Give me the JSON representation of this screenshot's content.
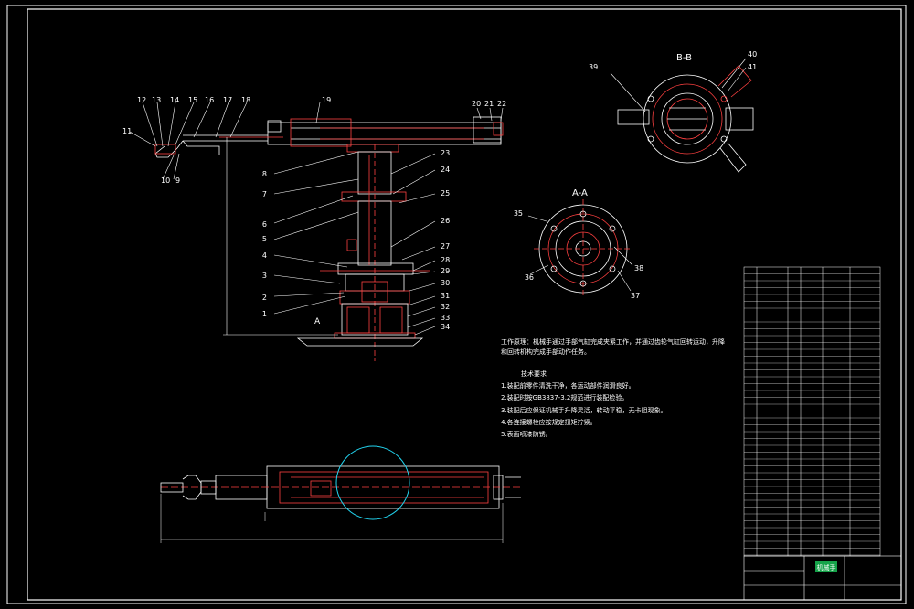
{
  "section_labels": {
    "a_a": "A-A",
    "b_b": "B-B",
    "a_ref": "A"
  },
  "balloons_left": [
    "1",
    "2",
    "3",
    "4",
    "5",
    "6",
    "7",
    "8"
  ],
  "balloons_right": [
    "23",
    "24",
    "25",
    "26",
    "27",
    "28",
    "29",
    "30",
    "31",
    "32",
    "33",
    "34"
  ],
  "balloons_top": [
    "9",
    "10",
    "11",
    "12",
    "13",
    "14",
    "15",
    "16",
    "17",
    "18",
    "19",
    "20",
    "21",
    "22"
  ],
  "balloons_aa": [
    "35",
    "36",
    "37",
    "38"
  ],
  "balloons_bb": [
    "39",
    "40",
    "41"
  ],
  "notes": {
    "work_principle": "工作原理：机械手通过手部气缸完成夹紧工作，并通过齿轮气缸回转运动，升降",
    "work_principle_2": "和回转机构完成手部动作任务。",
    "tech_title": "技术要求",
    "req_1": "1.装配前零件清洗干净，各运动部件润滑良好。",
    "req_2": "2.装配时按GB3837-3.2规范进行装配检验。",
    "req_3": "3.装配后应保证机械手升降灵活，转动平稳，无卡阻现象。",
    "req_4": "4.各连接螺栓应按规定扭矩拧紧。",
    "req_5": "5.表面喷漆防锈。"
  },
  "title_block": {
    "stamp": "机械手"
  },
  "colors": {
    "background": "#000000",
    "line": "#ffffff",
    "accent": "#ff3030",
    "cyan": "#22d3ee",
    "green": "#22c55e"
  }
}
